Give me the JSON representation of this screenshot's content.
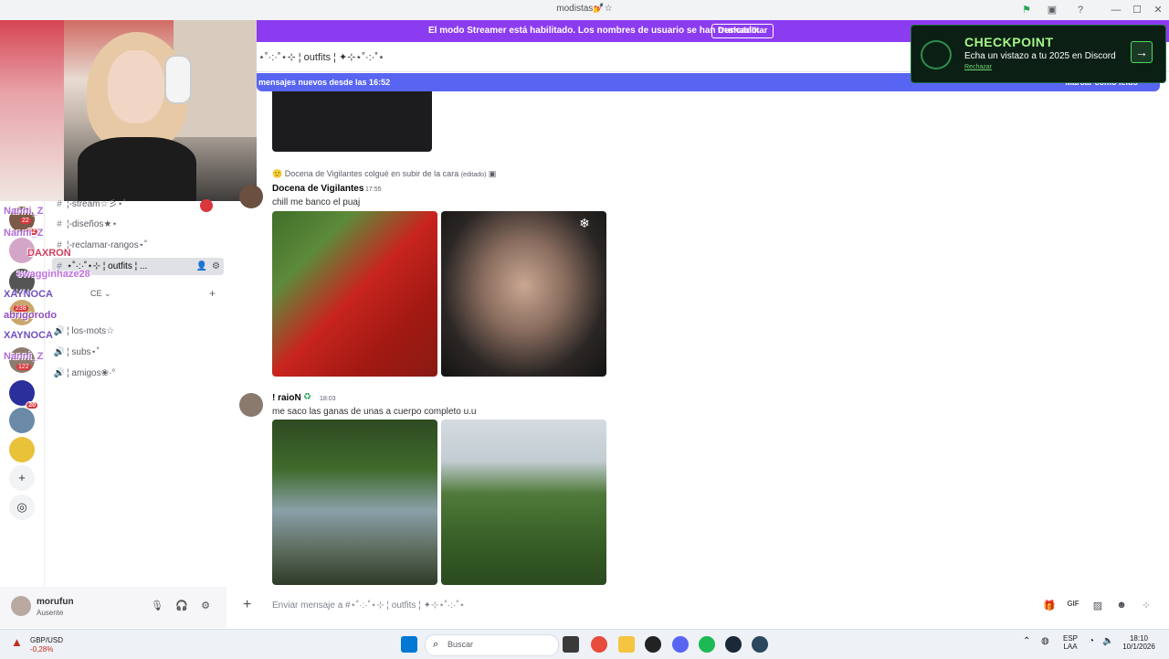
{
  "window": {
    "title": "modistas💅☆"
  },
  "banner": {
    "message": "El modo Streamer está habilitado. Los nombres de usuario se han truncado.",
    "button": "Deshabilitar"
  },
  "channel_header": {
    "name": "⋆˚·:·˚⋆⊹ ¦ outfits ¦ ✦⊹⋆˚·:·˚⋆"
  },
  "new_messages_bar": {
    "text": "mensajes nuevos desde las 16:52",
    "action": "Marcar como leído"
  },
  "checkpoint": {
    "title": "CHECKPOINT",
    "subtitle": "Echa un vistazo a tu 2025 en Discord",
    "dismiss": "Rechazar"
  },
  "server_rail": {
    "badges": [
      "22",
      "20",
      "122",
      "20"
    ]
  },
  "overlay_names": [
    "Nanni_Z",
    "Nanni_Z",
    "DAXRON",
    "swagginhaze28",
    "XAYNOCA",
    "abrigorodo",
    "XAYNOCA",
    "Nanni_Z"
  ],
  "overlay_counts": [
    "22",
    "238",
    "122"
  ],
  "channels": [
    {
      "label": "¦-stream☆彡⋆˚",
      "selected": false
    },
    {
      "label": "¦-diseños★⋆",
      "selected": false
    },
    {
      "label": "¦-reclamar-rangos⋆˚",
      "selected": false
    },
    {
      "label": "⋆˚·:·˚⋆⊹ ¦ outfits ¦ ...",
      "selected": true
    },
    {
      "label": "¦ los-mots☆",
      "selected": false
    },
    {
      "label": "¦ subs⋆˚",
      "selected": false
    },
    {
      "label": "¦ amigos❀·°",
      "selected": false
    }
  ],
  "category": {
    "label": "CE"
  },
  "user_panel": {
    "name": "morufun",
    "status": "Ausente"
  },
  "messages": [
    {
      "system": "Docena de Vigilantes colgué en subir de la cara",
      "edited": "(editado)",
      "author": "Docena de Vigilantes",
      "time": "17:55",
      "content": "chill me banco el puaj"
    },
    {
      "author": "! raioN",
      "time": "18:03",
      "content": "me saco las ganas de unas a cuerpo completo u.u"
    }
  ],
  "composer": {
    "placeholder": "Enviar mensaje a #⋆˚·:·˚⋆⊹ ¦ outfits ¦ ✦⊹⋆˚·:·˚⋆"
  },
  "taskbar": {
    "stock_name": "GBP/USD",
    "stock_change": "-0,28%",
    "search_placeholder": "Buscar",
    "language": "ESP",
    "language_sub": "LAA",
    "time": "18:10",
    "date": "10/1/2026"
  },
  "colors": {
    "streamer_banner": "#8c3cf0",
    "new_messages": "#5865f2",
    "checkpoint_bg": "#0b1f14",
    "checkpoint_accent": "#a6f58a"
  }
}
